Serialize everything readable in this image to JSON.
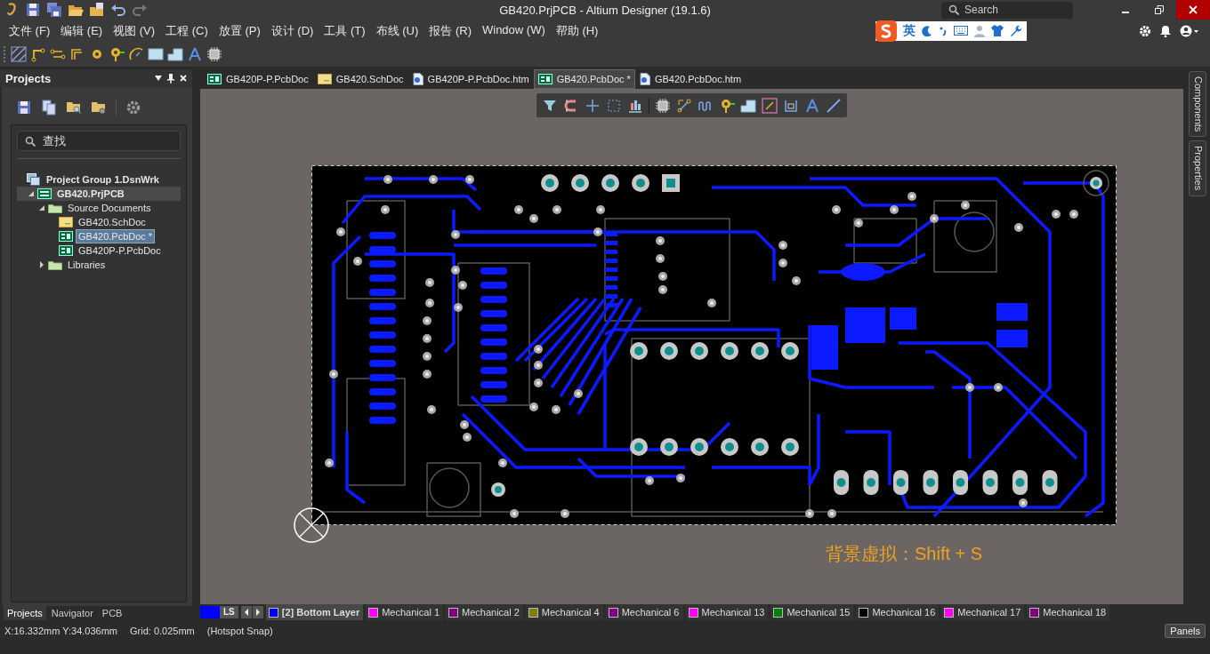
{
  "window": {
    "title": "GB420.PrjPCB - Altium Designer (19.1.6)",
    "search_placeholder": "Search"
  },
  "menu": [
    "文件 (F)",
    "编辑 (E)",
    "视图 (V)",
    "工程 (C)",
    "放置 (P)",
    "设计 (D)",
    "工具 (T)",
    "布线 (U)",
    "报告 (R)",
    "Window (W)",
    "帮助 (H)"
  ],
  "ime_bar": {
    "mode": "英"
  },
  "projects_panel": {
    "title": "Projects",
    "search_placeholder": "查找",
    "tree": [
      {
        "label": "Project Group 1.DsnWrk",
        "kind": "workspace",
        "selected": false,
        "children": [
          {
            "label": "GB420.PrjPCB",
            "kind": "project",
            "expanded": true,
            "selected": false,
            "children": [
              {
                "label": "Source Documents",
                "kind": "folder",
                "expanded": true,
                "selected": false,
                "children": [
                  {
                    "label": "GB420.SchDoc",
                    "kind": "schdoc",
                    "selected": false
                  },
                  {
                    "label": "GB420.PcbDoc *",
                    "kind": "pcbdoc",
                    "selected": true
                  },
                  {
                    "label": "GB420P-P.PcbDoc",
                    "kind": "pcbdoc",
                    "selected": false
                  }
                ]
              },
              {
                "label": "Libraries",
                "kind": "folder",
                "expanded": false,
                "selected": false
              }
            ]
          }
        ]
      }
    ],
    "tabs": [
      {
        "label": "Projects",
        "selected": true
      },
      {
        "label": "Navigator",
        "selected": false
      },
      {
        "label": "PCB",
        "selected": false
      }
    ]
  },
  "document_tabs": [
    {
      "label": "GB420P-P.PcbDoc",
      "kind": "pcbdoc",
      "selected": false
    },
    {
      "label": "GB420.SchDoc",
      "kind": "schdoc",
      "selected": false
    },
    {
      "label": "GB420P-P.PcbDoc.htm",
      "kind": "htm",
      "selected": false
    },
    {
      "label": "GB420.PcbDoc *",
      "kind": "pcbdoc",
      "selected": true
    },
    {
      "label": "GB420.PcbDoc.htm",
      "kind": "htm",
      "selected": false
    }
  ],
  "canvas": {
    "hint": "背景虚拟：Shift + S"
  },
  "layer_bar": {
    "ls_label": "LS",
    "layers": [
      {
        "label": "[2] Bottom Layer",
        "color": "#0000ff",
        "selected": true
      },
      {
        "label": "Mechanical 1",
        "color": "#ff00ff",
        "selected": false
      },
      {
        "label": "Mechanical 2",
        "color": "#800080",
        "selected": false
      },
      {
        "label": "Mechanical 4",
        "color": "#808000",
        "selected": false
      },
      {
        "label": "Mechanical 6",
        "color": "#800080",
        "selected": false
      },
      {
        "label": "Mechanical 13",
        "color": "#ff00ff",
        "selected": false
      },
      {
        "label": "Mechanical 15",
        "color": "#008000",
        "selected": false
      },
      {
        "label": "Mechanical 16",
        "color": "#000000",
        "selected": false
      },
      {
        "label": "Mechanical 17",
        "color": "#ff00ff",
        "selected": false
      },
      {
        "label": "Mechanical 18",
        "color": "#800080",
        "selected": false
      }
    ]
  },
  "side_tabs": [
    "Components",
    "Properties"
  ],
  "status_bar": {
    "coordinates": "X:16.332mm Y:34.036mm",
    "grid": "Grid: 0.025mm",
    "snap": "(Hotspot Snap)",
    "panels_button": "Panels"
  }
}
